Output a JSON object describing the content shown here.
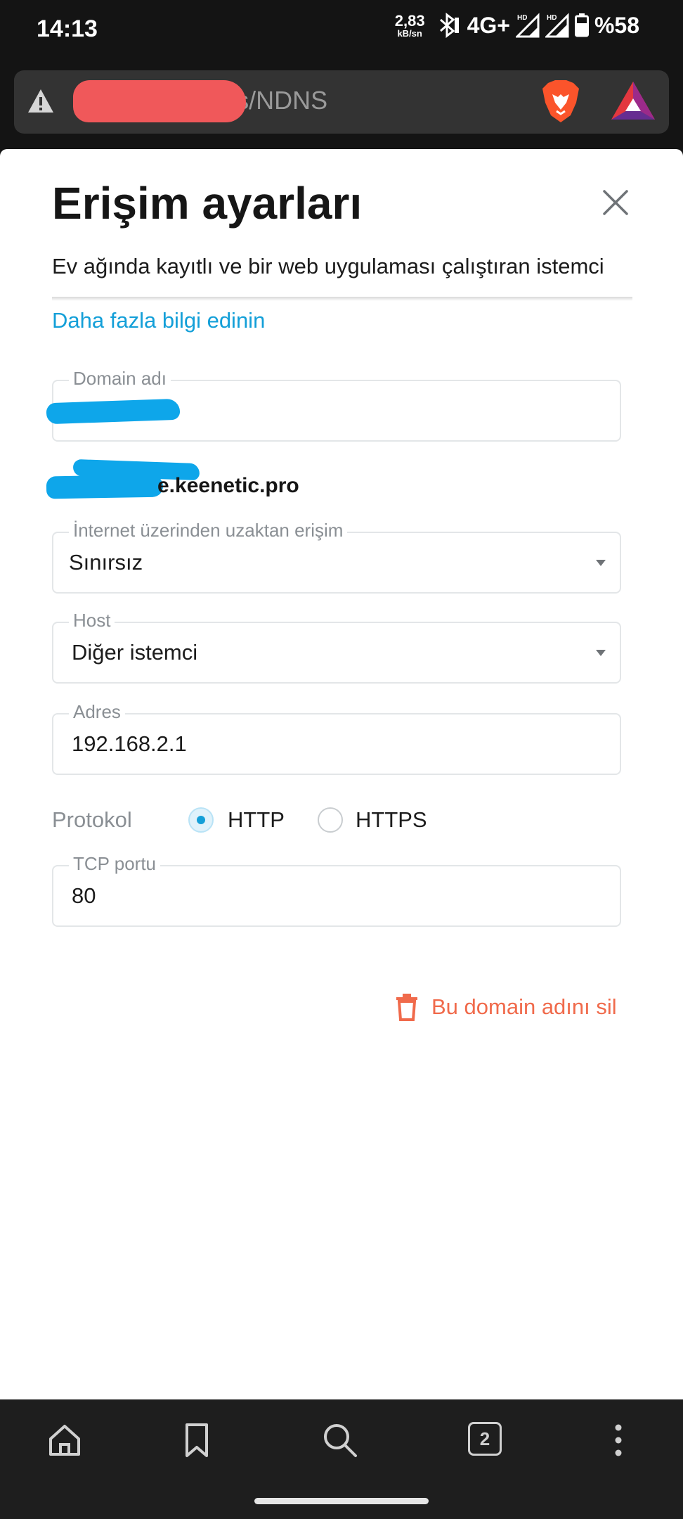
{
  "status_bar": {
    "time": "14:13",
    "speed_value": "2,83",
    "speed_unit": "kB/sn",
    "network": "4G+",
    "hd_badge": "HD",
    "battery": "%58"
  },
  "browser": {
    "url_text": "RemoteAccess/NDNS",
    "tab_count": "2"
  },
  "sheet": {
    "title": "Erişim ayarları",
    "description": "Ev ağında kayıtlı ve bir web uygulaması çalıştıran istemci seçin. Bu uygulamanın kullandığı TCP portunu belirtin ve",
    "more_link": "Daha fazla bilgi edinin",
    "domain": {
      "label": "Domain adı",
      "value": ""
    },
    "domain_suffix": "e.keenetic.pro",
    "remote_access": {
      "label": "İnternet üzerinden uzaktan erişim",
      "value": "Sınırsız"
    },
    "host": {
      "label": "Host",
      "value": "Diğer istemci"
    },
    "address": {
      "label": "Adres",
      "value": "192.168.2.1"
    },
    "protocol": {
      "label": "Protokol",
      "options": [
        "HTTP",
        "HTTPS"
      ],
      "selected": "HTTP"
    },
    "tcp_port": {
      "label": "TCP portu",
      "value": "80"
    },
    "delete_label": "Bu domain adını sil"
  },
  "colors": {
    "accent": "#139fd8",
    "danger": "#f06a4b",
    "redaction_red": "#f0585a",
    "redaction_blue": "#0ea6ea"
  },
  "icons": [
    "warning-icon",
    "brave-lion-icon",
    "bat-triangle-icon",
    "close-icon",
    "chevron-down-icon",
    "trash-icon",
    "home-icon",
    "bookmark-icon",
    "search-icon",
    "tabs-icon",
    "more-vert-icon"
  ]
}
